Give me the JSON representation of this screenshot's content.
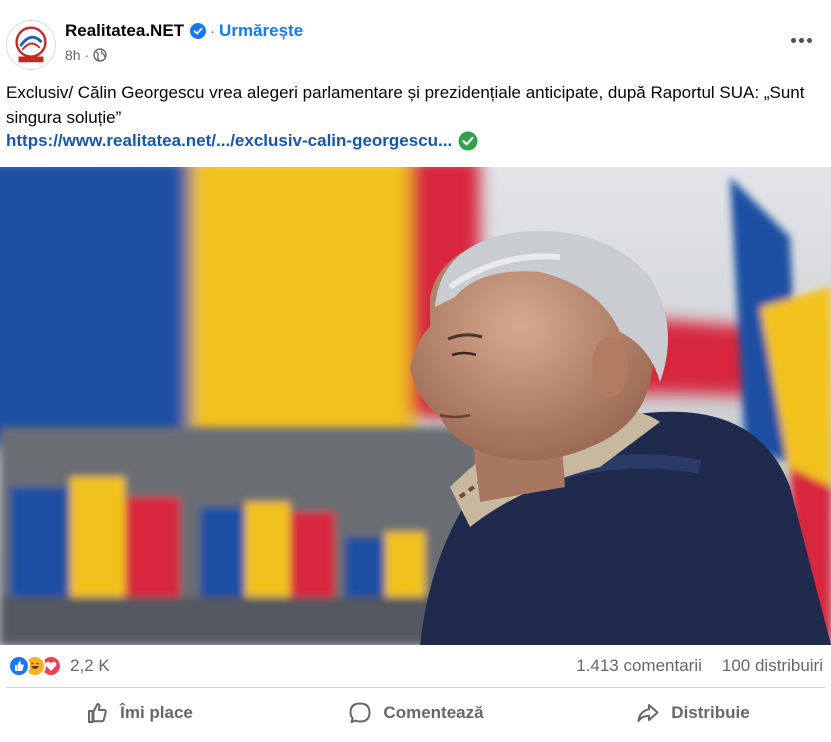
{
  "post": {
    "page_name": "Realitatea.NET",
    "follow_label": "Urmărește",
    "separator": "·",
    "time": "8h",
    "text": "Exclusiv/ Călin Georgescu vrea alegeri parlamentare și prezidențiale anticipate, după Raportul SUA: „Sunt singura soluție”",
    "link": "https://www.realitatea.net/.../exclusiv-calin-georgescu...",
    "icons": {
      "verified": "verified-badge-icon",
      "globe": "globe-icon",
      "more": "more-options-icon",
      "link_check": "check-circle-icon"
    }
  },
  "stats": {
    "reactions_count": "2,2 K",
    "reaction_icons": [
      "like-reaction-icon",
      "haha-reaction-icon",
      "love-reaction-icon"
    ],
    "comments": "1.413 comentarii",
    "shares": "100 distribuiri"
  },
  "actions": {
    "like": "Îmi place",
    "comment": "Comentează",
    "share": "Distribuie"
  },
  "colors": {
    "accent": "#1877f2",
    "link": "#1a56a8",
    "verified_green": "#31a24c",
    "muted": "#65676b"
  }
}
